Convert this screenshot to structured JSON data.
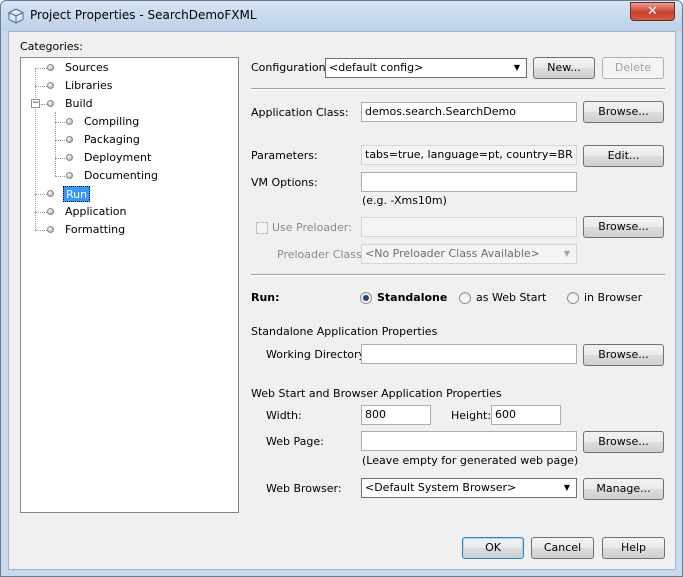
{
  "window": {
    "title": "Project Properties - SearchDemoFXML",
    "close_glyph": "✕"
  },
  "categories": {
    "label": "Categories:",
    "items": [
      {
        "label": "Sources"
      },
      {
        "label": "Libraries"
      },
      {
        "label": "Build"
      },
      {
        "label": "Compiling"
      },
      {
        "label": "Packaging"
      },
      {
        "label": "Deployment"
      },
      {
        "label": "Documenting"
      },
      {
        "label": "Run"
      },
      {
        "label": "Application"
      },
      {
        "label": "Formatting"
      }
    ],
    "selected": "Run"
  },
  "configuration": {
    "label": "Configuration:",
    "value": "<default config>",
    "new_button": "New...",
    "delete_button": "Delete"
  },
  "application_class": {
    "label": "Application Class:",
    "value": "demos.search.SearchDemo",
    "browse_button": "Browse..."
  },
  "parameters": {
    "label": "Parameters:",
    "value": "tabs=true, language=pt, country=BR",
    "edit_button": "Edit..."
  },
  "vm_options": {
    "label": "VM Options:",
    "value": "",
    "hint": "(e.g. -Xms10m)"
  },
  "preloader": {
    "checkbox_label": "Use Preloader:",
    "value": "",
    "browse_button": "Browse...",
    "class_label": "Preloader Class:",
    "class_value": "<No Preloader Class Available>"
  },
  "run": {
    "label": "Run:",
    "options": [
      "Standalone",
      "as Web Start",
      "in Browser"
    ],
    "selected": "Standalone"
  },
  "standalone": {
    "heading": "Standalone Application Properties",
    "working_dir_label": "Working Directory:",
    "working_dir_value": "",
    "browse_button": "Browse..."
  },
  "webstart": {
    "heading": "Web Start and Browser Application Properties",
    "width_label": "Width:",
    "width_value": "800",
    "height_label": "Height:",
    "height_value": "600",
    "web_page_label": "Web Page:",
    "web_page_value": "",
    "web_page_browse": "Browse...",
    "web_page_hint": "(Leave empty for generated web page)",
    "browser_label": "Web Browser:",
    "browser_value": "<Default System Browser>",
    "manage_button": "Manage..."
  },
  "footer": {
    "ok": "OK",
    "cancel": "Cancel",
    "help": "Help"
  }
}
